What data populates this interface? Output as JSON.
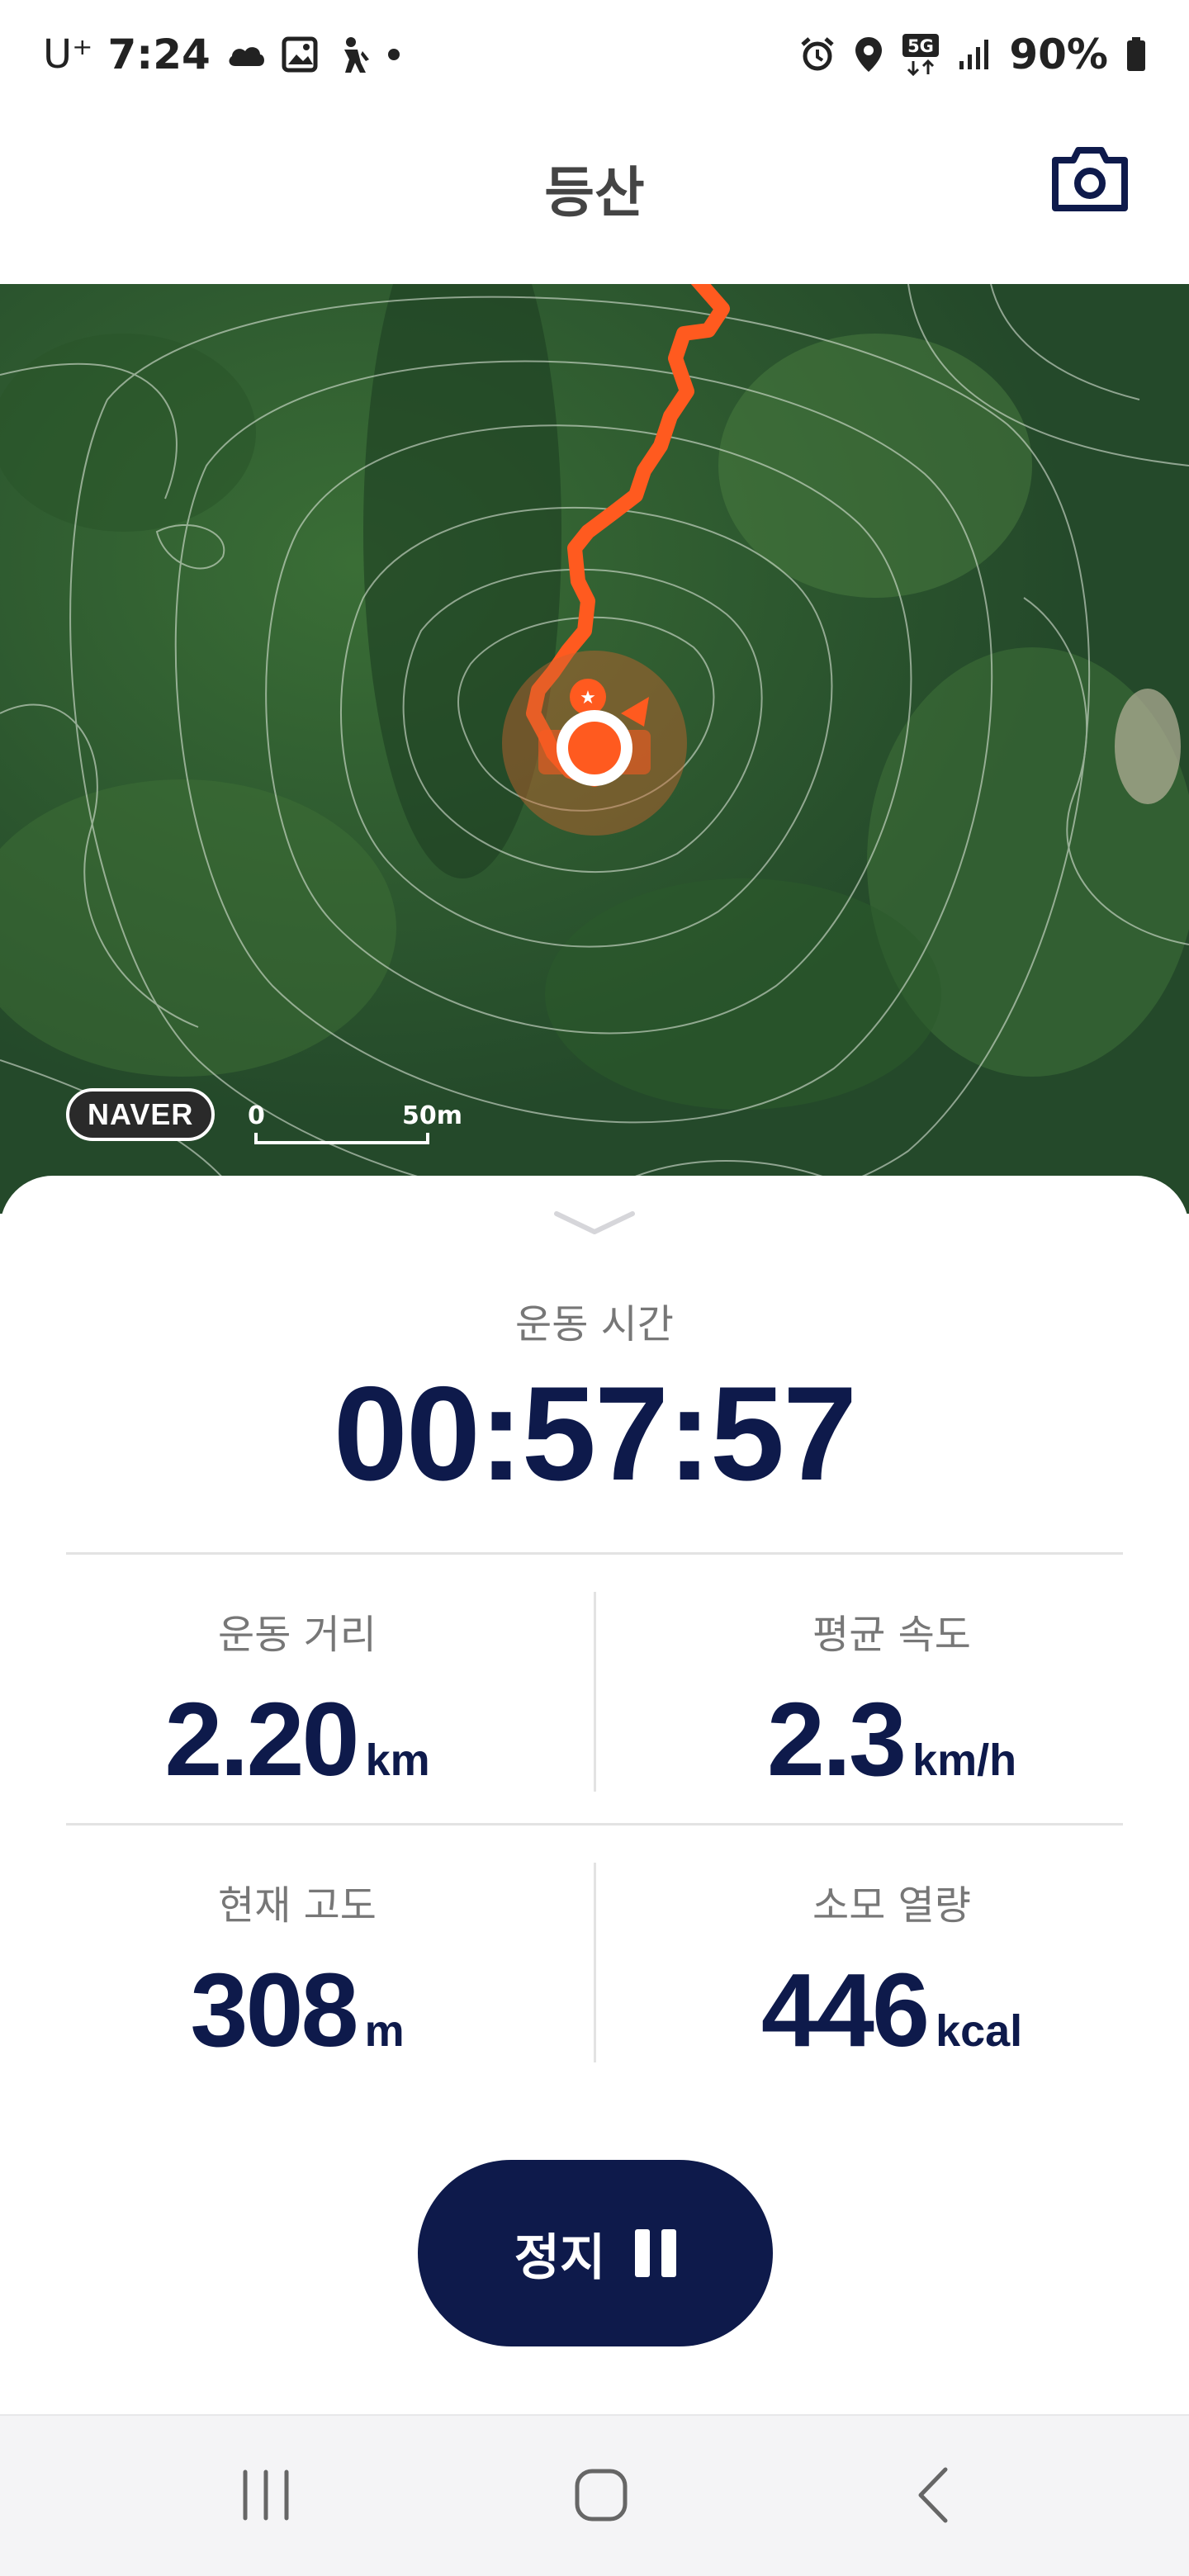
{
  "status_bar": {
    "carrier": "U⁺",
    "time": "7:24",
    "battery": "90%",
    "left_icons": [
      "cloud-icon",
      "gallery-icon",
      "hiking-person-icon",
      "dot-icon"
    ],
    "right_icons": [
      "alarm-icon",
      "location-icon",
      "5g-icon",
      "signal-icon",
      "battery-icon"
    ]
  },
  "header": {
    "title": "등산",
    "camera_icon": "camera-icon"
  },
  "map": {
    "provider": "NAVER",
    "scale_start": "0",
    "scale_label": "50m",
    "route_color": "#ff5a1f",
    "marker_icon": "current-location-icon"
  },
  "workout": {
    "time_label": "운동 시간",
    "time_value": "00:57:57",
    "stats": [
      {
        "label": "운동 거리",
        "value": "2.20",
        "unit": "km"
      },
      {
        "label": "평균 속도",
        "value": "2.3",
        "unit": "km/h"
      },
      {
        "label": "현재 고도",
        "value": "308",
        "unit": "m"
      },
      {
        "label": "소모 열량",
        "value": "446",
        "unit": "kcal"
      }
    ],
    "pause_label": "정지",
    "accent_color": "#0e1a4b"
  },
  "nav_bar": {
    "icons": [
      "recent-apps-icon",
      "home-icon",
      "back-icon"
    ]
  }
}
